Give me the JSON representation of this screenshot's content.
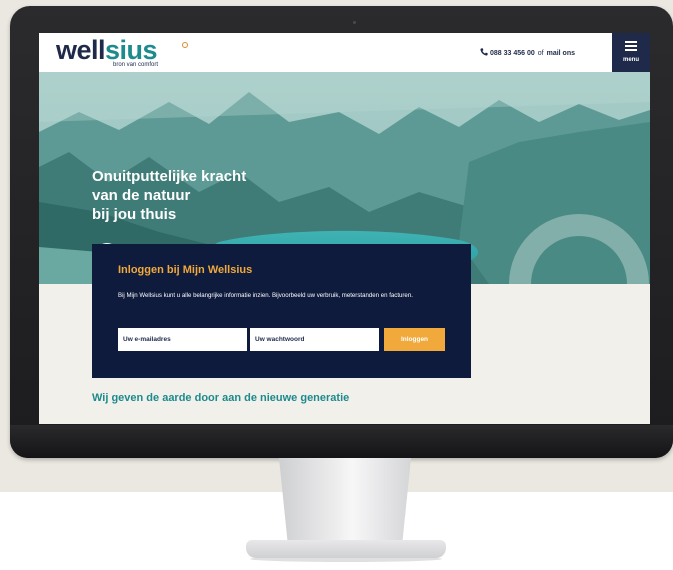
{
  "header": {
    "logo_well": "well",
    "logo_sius": "sius",
    "tagline": "bron van comfort",
    "phone": "088 33 456 00",
    "phone_separator": "of",
    "mail_link": "mail ons",
    "menu_label": "menu"
  },
  "hero": {
    "title_line1": "Onuitputtelijke kracht",
    "title_line2": "van de natuur",
    "title_line3": "bij jou thuis"
  },
  "login": {
    "title": "Inloggen bij Mijn Wellsius",
    "text": "Bij Mijn Wellsius kunt u alle belangrijke informatie inzien. Bijvoorbeeld uw verbruik, meterstanden en facturen.",
    "email_placeholder": "Uw e-mailadres",
    "password_placeholder": "Uw wachtwoord",
    "button_label": "Inloggen"
  },
  "section": {
    "heading": "Wij geven de aarde door aan de nieuwe generatie"
  },
  "colors": {
    "navy": "#1f2a4a",
    "login_bg": "#0f1b3d",
    "teal": "#1d8a8e",
    "orange": "#f0a93a"
  },
  "icons": {
    "phone": "phone-icon",
    "menu": "hamburger-icon",
    "scroll_down": "arrow-down-circle-icon"
  }
}
